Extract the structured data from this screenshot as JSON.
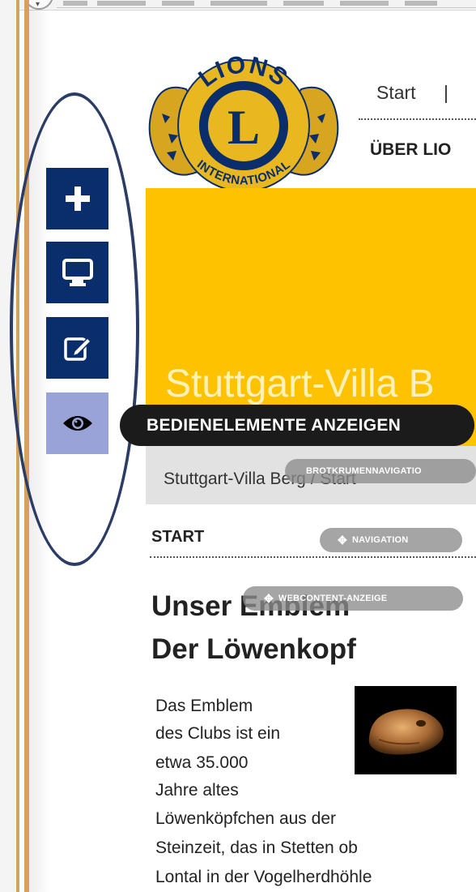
{
  "colors": {
    "navy": "#0a2d6b",
    "banner_yellow": "#ffc200",
    "eye_button": "#9aa3d8",
    "frame_border": "#d4a260"
  },
  "control_menu": {
    "buttons": [
      {
        "icon": "plus-icon"
      },
      {
        "icon": "monitor-icon"
      },
      {
        "icon": "edit-icon"
      },
      {
        "icon": "eye-icon"
      }
    ],
    "tooltip": "BEDIENELEMENTE ANZEIGEN"
  },
  "logo": {
    "top_text": "LIONS",
    "bottom_text": "INTERNATIONAL",
    "center_letter": "L"
  },
  "top_nav": {
    "start": "Start",
    "separator": "|",
    "section": "ÜBER LIO"
  },
  "banner": {
    "title": "Stuttgart-Villa B"
  },
  "breadcrumb": {
    "text": "Stuttgart-Villa Berg / Start",
    "portlet_label": "BROTKRUMENNAVIGATIO"
  },
  "navigation": {
    "heading": "START",
    "portlet_label": "NAVIGATION"
  },
  "webcontent": {
    "portlet_label": "WEBCONTENT-ANZEIGE"
  },
  "article": {
    "title_line1": "Unser Emblem",
    "title_line2": "Der Löwenkopf",
    "lines": [
      "Das Emblem",
      "des Clubs ist ein",
      "etwa 35.000",
      "Jahre altes",
      "Löwenköpfchen aus der",
      "Steinzeit, das in Stetten ob",
      "Lontal in der Vogelherdhöhle"
    ],
    "image_icon": "lion-head-figurine"
  }
}
